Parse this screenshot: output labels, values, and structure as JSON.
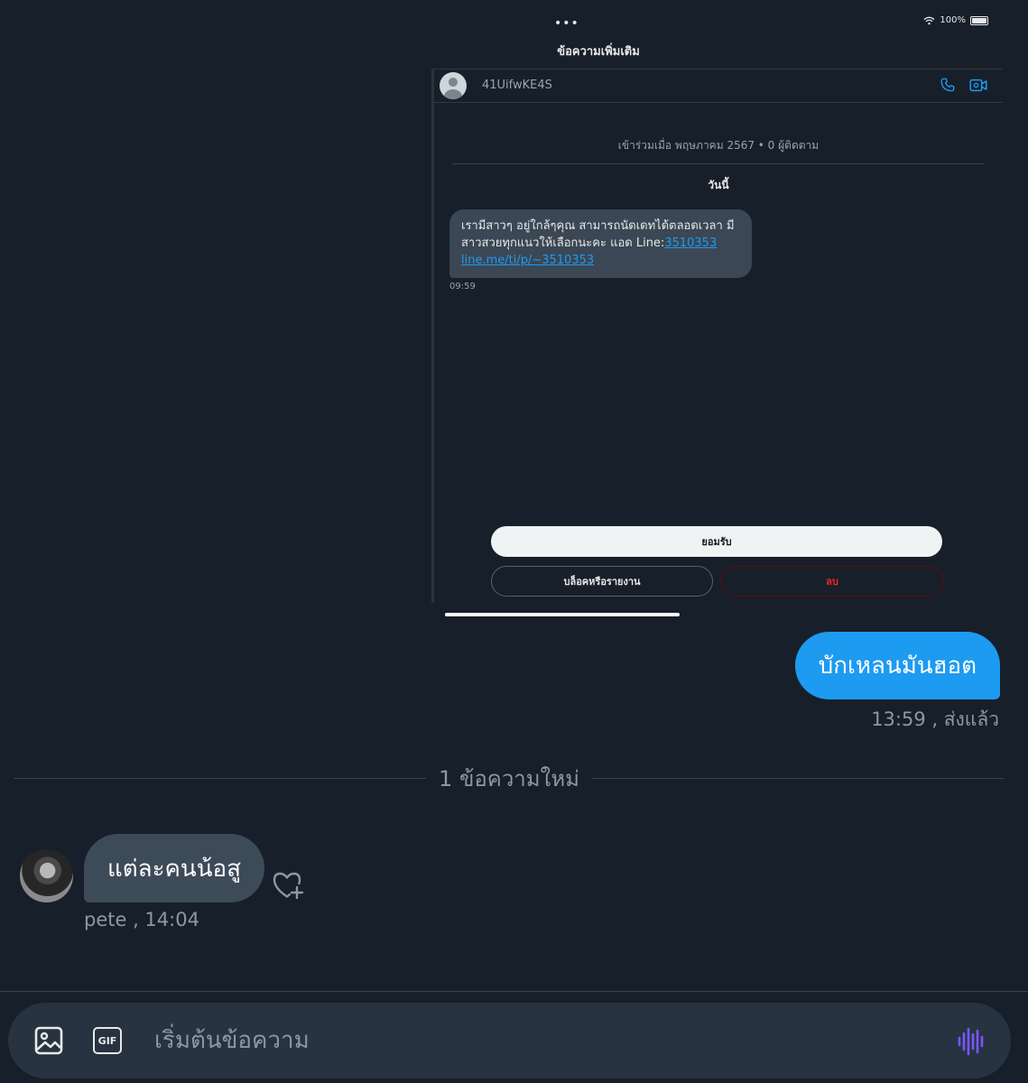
{
  "shot": {
    "dots": "•••",
    "battery": "100%",
    "title": "ข้อความเพิ่มเติม",
    "handle": "41UifwKE4S",
    "joined": "เข้าร่วมเมื่อ พฤษภาคม 2567 • 0 ผู้ติดตาม",
    "today": "วันนี้",
    "spam_text": "เรามีสาวๆ อยู่ใกล้ๆคุณ สามารถนัดเดทได้ตลอดเวลา มีสาวสวยทุกแนวให้เลือกนะคะ แอด Line:",
    "spam_link1": "3510353",
    "spam_link2": "line.me/ti/p/~3510353",
    "spam_time": "09:59",
    "accept": "ยอมรับ",
    "block": "บล็อคหรือรายงาน",
    "delete": "ลบ"
  },
  "outgoing": {
    "text": "บักเหลนมันฮอต",
    "meta": "13:59 , ส่งแล้ว"
  },
  "divider": {
    "label": "1 ข้อความใหม่"
  },
  "incoming": {
    "text": "แต่ละคนน้อสู",
    "meta": "pete , 14:04"
  },
  "composer": {
    "placeholder": "เริ่มต้นข้อความ",
    "gif_label": "GIF"
  },
  "colors": {
    "background": "#171f2a",
    "accent": "#1d9bf0",
    "voice": "#7856ff"
  }
}
